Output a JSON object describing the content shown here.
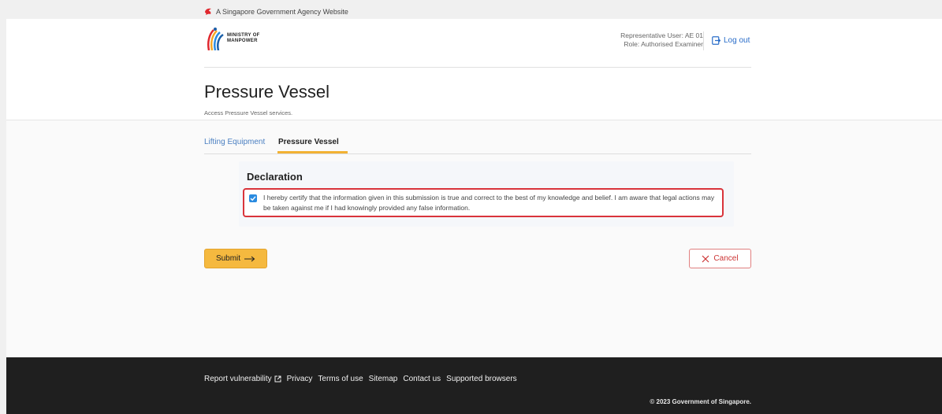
{
  "masthead": {
    "text": "A Singapore Government Agency Website",
    "icon": "lion-head-icon"
  },
  "header": {
    "logo_line1": "MINISTRY OF",
    "logo_line2": "MANPOWER",
    "user": "Representative User: AE 01",
    "role": "Role: Authorised Examiner",
    "logout_label": "Log out"
  },
  "page": {
    "title": "Pressure Vessel",
    "subtitle": "Access Pressure Vessel services."
  },
  "tabs": [
    {
      "label": "Lifting Equipment",
      "active": false
    },
    {
      "label": "Pressure Vessel",
      "active": true
    }
  ],
  "declaration": {
    "title": "Declaration",
    "checked": true,
    "text": "I hereby certify that the information given in this submission is true and correct to the best of my knowledge and belief. I am aware that legal actions may be taken against me if I had knowingly provided any false information."
  },
  "actions": {
    "submit_label": "Submit",
    "cancel_label": "Cancel"
  },
  "footer": {
    "links": [
      "Report vulnerability",
      "Privacy",
      "Terms of use",
      "Sitemap",
      "Contact us",
      "Supported browsers"
    ],
    "copyright": "© 2023 Government of Singapore."
  },
  "colors": {
    "accent": "#f5b93f",
    "link": "#2a6dc9",
    "danger": "#d9343b",
    "footer_bg": "#1f1f1f"
  }
}
